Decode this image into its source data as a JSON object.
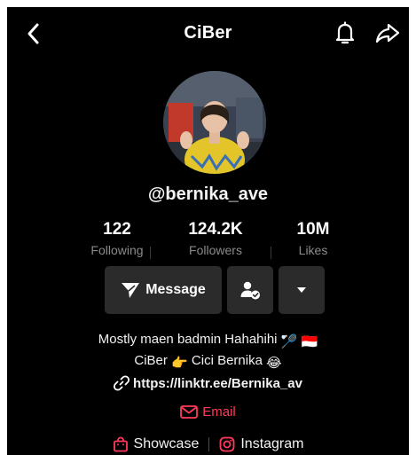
{
  "header": {
    "title": "CiBer",
    "back_icon": "chevron-left-icon",
    "bell_icon": "bell-icon",
    "share_icon": "share-arrow-icon"
  },
  "profile": {
    "handle": "@bernika_ave",
    "avatar_icon": "profile-photo",
    "stats": [
      {
        "value": "122",
        "label": "Following"
      },
      {
        "value": "124.2K",
        "label": "Followers"
      },
      {
        "value": "10M",
        "label": "Likes"
      }
    ]
  },
  "actions": {
    "message_label": "Message",
    "message_icon": "send-arrow-icon",
    "follow_icon": "user-check-icon",
    "more_icon": "caret-down-icon"
  },
  "bio": {
    "line1": "Mostly maen badmin Hahahihi",
    "line2a": "CiBer",
    "line2b": "Cici Bernika",
    "emoji_1": "🏸",
    "emoji_2": "🇮🇩",
    "emoji_3": "👉",
    "emoji_4": "😂"
  },
  "link": {
    "url": "https://linktr.ee/Bernika_av",
    "icon": "link-icon"
  },
  "email": {
    "label": "Email",
    "icon": "mail-icon"
  },
  "bottom_links": {
    "showcase": "Showcase",
    "instagram": "Instagram"
  },
  "colors": {
    "background": "#000000",
    "button": "#2b2b2b",
    "accent": "#ff3b5c",
    "muted": "#8a8a8a"
  }
}
